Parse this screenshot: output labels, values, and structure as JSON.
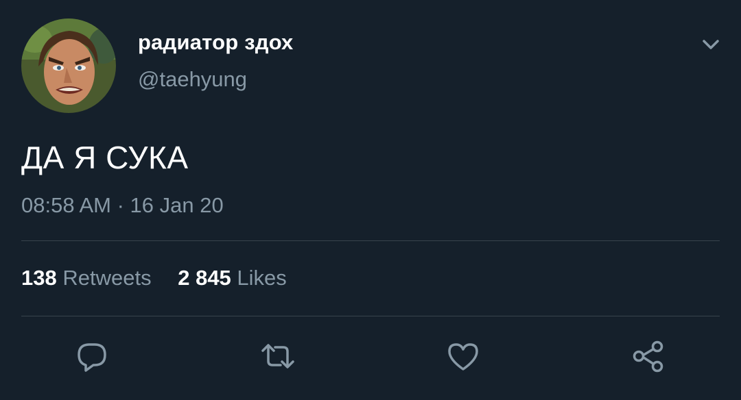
{
  "tweet": {
    "author": {
      "display_name": "радиатор здох",
      "handle": "@taehyung"
    },
    "text": "ДА Я СУКА",
    "timestamp": "08:58 AM · 16 Jan 20",
    "stats": {
      "retweets_count": "138",
      "retweets_label": "Retweets",
      "likes_count": "2 845",
      "likes_label": "Likes"
    }
  },
  "icons": {
    "menu": "chevron-down-icon",
    "reply": "reply-icon",
    "retweet": "retweet-icon",
    "like": "heart-icon",
    "share": "share-icon"
  },
  "colors": {
    "background": "#15202b",
    "primary_text": "#ffffff",
    "secondary_text": "#8899a6",
    "divider": "#38444d"
  }
}
